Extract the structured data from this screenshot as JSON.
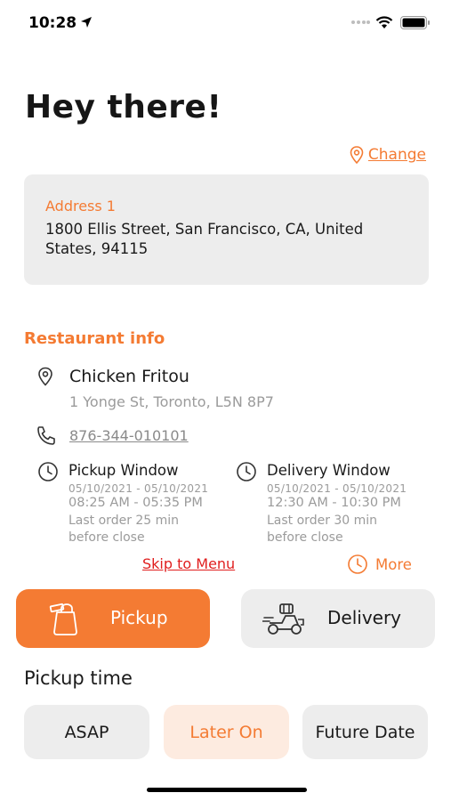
{
  "status_bar": {
    "time": "10:28"
  },
  "greeting": "Hey there!",
  "change_link": "Change",
  "address": {
    "label": "Address 1",
    "line1": "1800 Ellis Street, San Francisco, CA, United",
    "line2": "States, 94115"
  },
  "restaurant_info": {
    "title": "Restaurant info",
    "name": "Chicken Fritou",
    "address": "1 Yonge St, Toronto, L5N 8P7",
    "phone": "876-344-010101"
  },
  "pickup_window": {
    "title": "Pickup Window",
    "dates": "05/10/2021 - 05/10/2021",
    "hours": "08:25 AM - 05:35 PM",
    "last_order_1": "Last order 25 min",
    "last_order_2": "before close"
  },
  "delivery_window": {
    "title": "Delivery Window",
    "dates": "05/10/2021 - 05/10/2021",
    "hours": "12:30 AM - 10:30 PM",
    "last_order_1": "Last order 30 min",
    "last_order_2": "before close"
  },
  "skip_to_menu": "Skip to Menu",
  "more": "More",
  "modes": {
    "pickup": "Pickup",
    "delivery": "Delivery",
    "selected": "Pickup"
  },
  "pickup_time": {
    "title": "Pickup time",
    "options": [
      "ASAP",
      "Later On",
      "Future Date"
    ],
    "selected": "Later On"
  },
  "colors": {
    "accent": "#f47b33",
    "card": "#ededed",
    "selected_soft": "#fdebe0",
    "link_red": "#e01e1e"
  },
  "icons": [
    "location-arrow-icon",
    "signal-dots-icon",
    "wifi-icon",
    "battery-icon",
    "location-pin-icon",
    "phone-icon",
    "clock-icon",
    "shopping-bag-icon",
    "delivery-scooter-icon"
  ]
}
